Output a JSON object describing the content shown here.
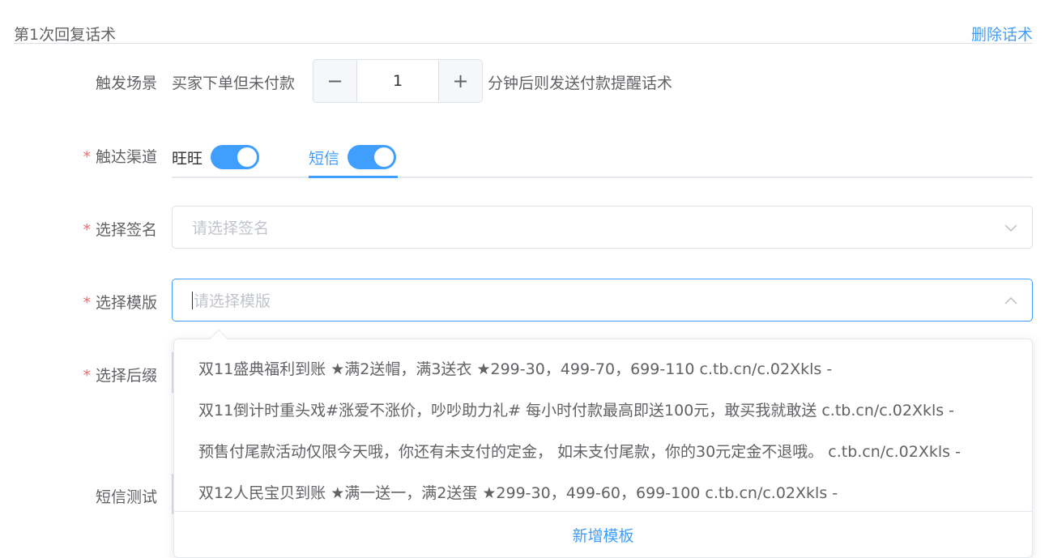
{
  "header": {
    "title": "第1次回复话术",
    "delete_label": "删除话术"
  },
  "trigger": {
    "label": "触发场景",
    "prefix": "买家下单但未付款",
    "stepper_value": "1",
    "minus_symbol": "−",
    "plus_symbol": "+",
    "suffix": "分钟后则发送付款提醒话术"
  },
  "channel": {
    "required_mark": "*",
    "label": "触达渠道",
    "tabs": [
      {
        "label": "旺旺",
        "enabled": true,
        "active": false
      },
      {
        "label": "短信",
        "enabled": true,
        "active": true
      }
    ]
  },
  "signature": {
    "required_mark": "*",
    "label": "选择签名",
    "placeholder": "请选择签名"
  },
  "template": {
    "required_mark": "*",
    "label": "选择模版",
    "placeholder": "请选择模版"
  },
  "suffix": {
    "required_mark": "*",
    "label": "选择后缀"
  },
  "sms_test": {
    "label": "短信测试"
  },
  "dropdown": {
    "options": [
      "双11盛典福利到账 ★满2送帽，满3送衣 ★299-30，499-70，699-110 c.tb.cn/c.02Xkls -",
      "双11倒计时重头戏#涨爱不涨价，吵吵助力礼# 每小时付款最高即送100元，敢买我就敢送 c.tb.cn/c.02Xkls -",
      "预售付尾款活动仅限今天哦，你还有未支付的定金， 如未支付尾款，你的30元定金不退哦。 c.tb.cn/c.02Xkls -",
      "双12人民宝贝到账 ★满一送一，满2送蛋 ★299-30，499-60，699-100 c.tb.cn/c.02Xkls -"
    ],
    "add_label": "新增模板"
  },
  "colors": {
    "accent": "#409eff",
    "required": "#f56c6c",
    "border": "#dcdfe6",
    "placeholder": "#c0c4cc"
  }
}
